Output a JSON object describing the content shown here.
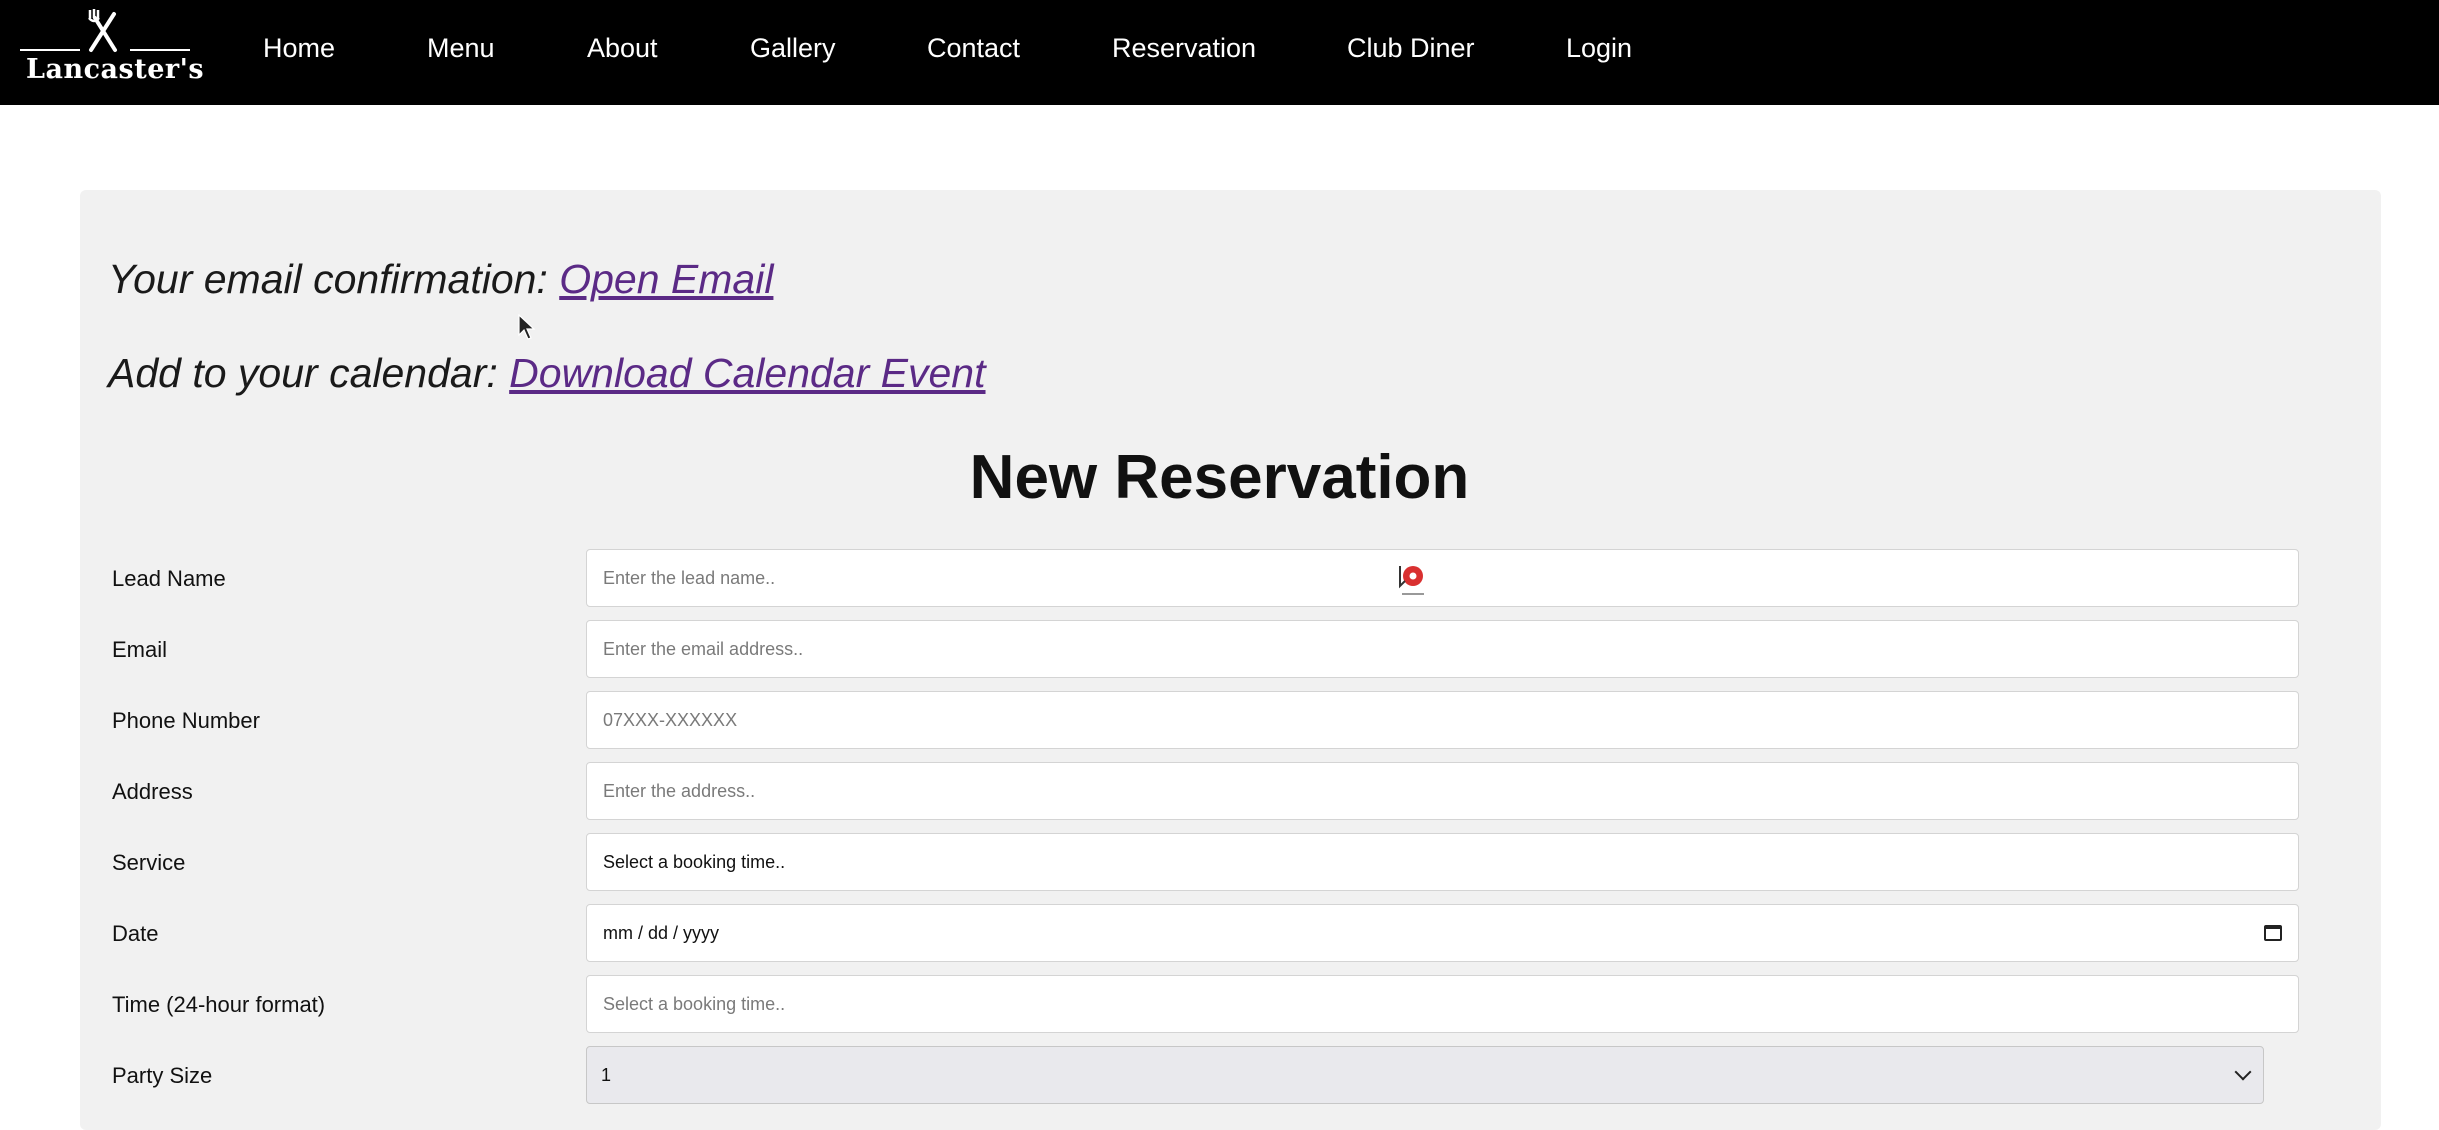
{
  "brand": {
    "logo_text": "Lancaster's"
  },
  "nav": {
    "items": [
      "Home",
      "Menu",
      "About",
      "Gallery",
      "Contact",
      "Reservation",
      "Club Diner",
      "Login"
    ]
  },
  "confirmation": {
    "email_prefix": "Your email confirmation:",
    "email_link": "Open Email",
    "calendar_prefix": "Add to your calendar:",
    "calendar_link": "Download Calendar Event"
  },
  "form": {
    "title": "New Reservation",
    "fields": {
      "lead_name": {
        "label": "Lead Name",
        "placeholder": "Enter the lead name.."
      },
      "email": {
        "label": "Email",
        "placeholder": "Enter the email address.."
      },
      "phone": {
        "label": "Phone Number",
        "placeholder": "07XXX-XXXXXX"
      },
      "address": {
        "label": "Address",
        "placeholder": "Enter the address.."
      },
      "service": {
        "label": "Service",
        "value": "Select a booking time.."
      },
      "date": {
        "label": "Date",
        "value": "mm / dd / yyyy"
      },
      "time": {
        "label": "Time (24-hour format)",
        "placeholder": "Select a booking time.."
      },
      "party_size": {
        "label": "Party Size",
        "value": "1"
      }
    }
  },
  "icons": {
    "logo": "crossed-fork-knife-icon",
    "calendar": "calendar-icon",
    "select": "chevron-down-icon",
    "cursor": "mouse-pointer-icon",
    "marker": "red-location-pin-icon"
  },
  "colors": {
    "navbar_bg": "#000000",
    "panel_bg": "#f1f1f1",
    "link": "#5b2a86"
  }
}
